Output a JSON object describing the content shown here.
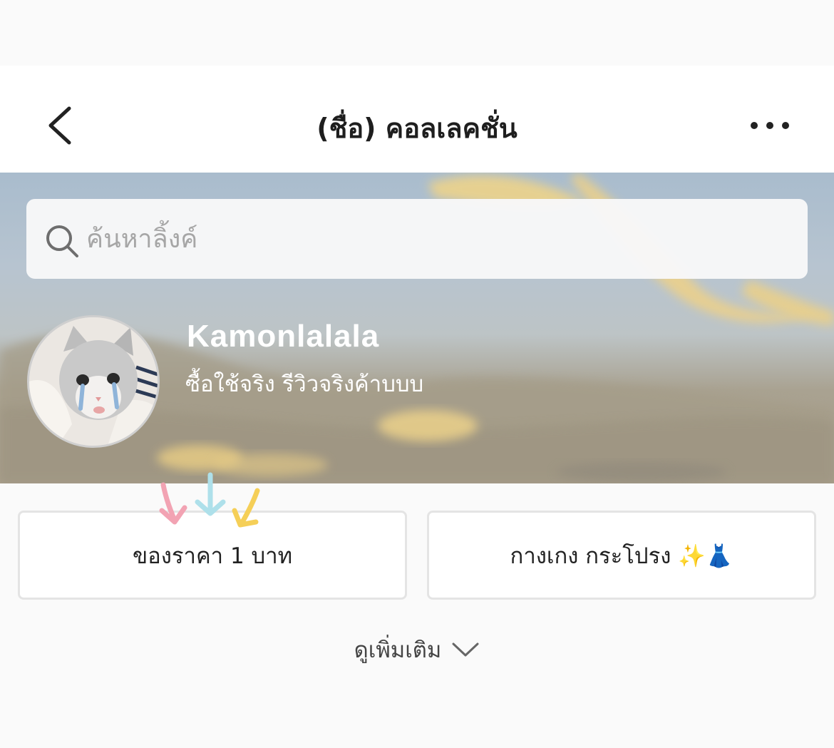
{
  "header": {
    "title": "(ชื่อ) คอลเลคชั่น"
  },
  "icons": {
    "back": "back-chevron-icon",
    "more": "more-dots-icon",
    "search": "search-icon",
    "see_more": "chevron-down-icon"
  },
  "search": {
    "placeholder": "ค้นหาลิ้งค์"
  },
  "profile": {
    "name": "Kamonlalala",
    "bio": "ซื้อใช้จริง รีวิวจริงค้าบบบ"
  },
  "links": [
    {
      "label": "ของราคา 1 บาท"
    },
    {
      "label": "กางเกง กระโปรง ✨👗"
    }
  ],
  "see_more": {
    "label": "ดูเพิ่มเติม"
  },
  "colors": {
    "arrow_pink": "#f2a3b3",
    "arrow_blue": "#aee0ea",
    "arrow_yellow": "#f5cf58",
    "title": "#1e1e1e"
  }
}
